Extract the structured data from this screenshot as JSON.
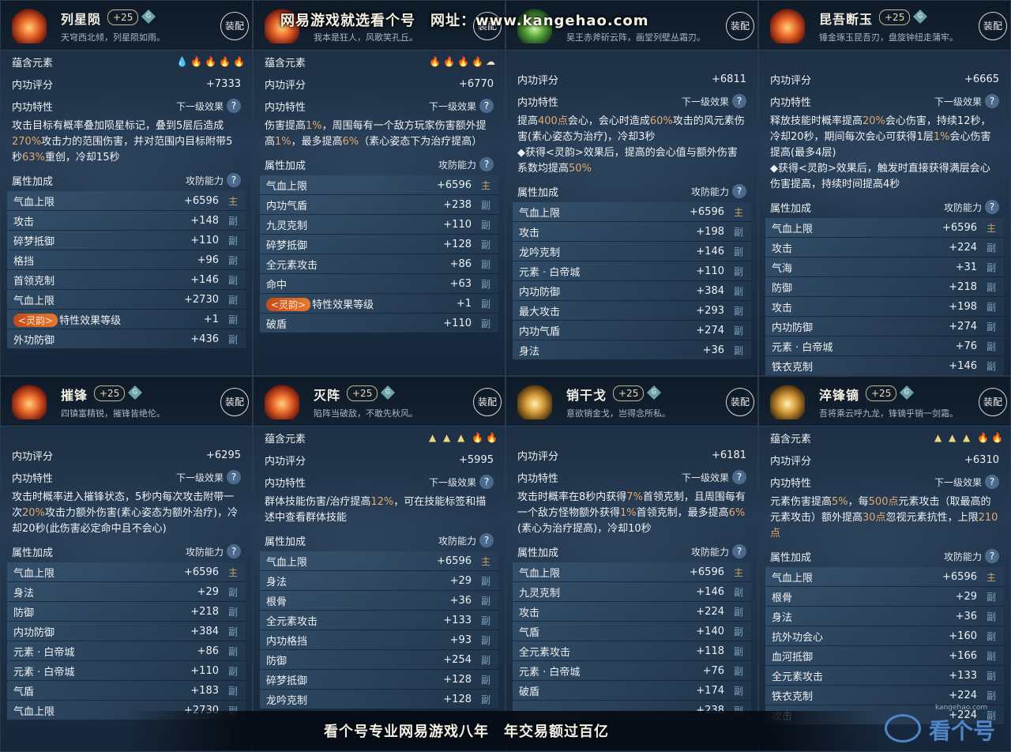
{
  "overlay": {
    "top_watermark": "网易游戏就选看个号　网址：www.kangehao.com",
    "bottom_banner": "看个号专业网易游戏八年　年交易额过百亿",
    "logo_text": "看个号",
    "site_small": "kangehao.com"
  },
  "labels": {
    "elements": "蕴含元素",
    "score": "内功评分",
    "trait": "内功特性",
    "next_effect": "下一级效果",
    "attrs": "属性加成",
    "atk_def": "攻防能力",
    "equip": "装配",
    "help": "?",
    "main": "主",
    "sub": "副",
    "lingyun": "<灵韵>"
  },
  "cards": [
    {
      "name": "列星陨",
      "level": "+25",
      "grade": "G",
      "quote": "天穹西北倾，列星陨如雨。",
      "icon": "fire",
      "elements": [
        "water",
        "fire",
        "fire",
        "fire",
        "fire"
      ],
      "score": "+7333",
      "desc": "攻击目标有概率叠加陨星标记，叠到5层后造成270%攻击力的范围伤害，并对范围内目标附带5秒63%重创，冷却15秒",
      "attrs": [
        {
          "name": "气血上限",
          "val": "+6596",
          "tag": "main"
        },
        {
          "name": "攻击",
          "val": "+148",
          "tag": "sub"
        },
        {
          "name": "碎梦抵御",
          "val": "+110",
          "tag": "sub"
        },
        {
          "name": "格挡",
          "val": "+96",
          "tag": "sub"
        },
        {
          "name": "首领克制",
          "val": "+146",
          "tag": "sub"
        },
        {
          "name": "气血上限",
          "val": "+2730",
          "tag": "sub"
        },
        {
          "name": "特性效果等级",
          "val": "+1",
          "tag": "sub",
          "lingyun": true
        },
        {
          "name": "外功防御",
          "val": "+436",
          "tag": "sub"
        }
      ]
    },
    {
      "name": "",
      "level": "",
      "grade": "",
      "quote": "我本是狂人，风歌笑孔丘。",
      "icon": "fire",
      "elements": [
        "fire",
        "fire",
        "fire",
        "fire",
        "cloud"
      ],
      "score": "+6770",
      "desc": "伤害提高1%，周围每有一个敌方玩家伤害额外提高1%，最多提高6%（素心姿态下为治疗提高）",
      "attrs": [
        {
          "name": "气血上限",
          "val": "+6596",
          "tag": "main"
        },
        {
          "name": "内功气盾",
          "val": "+238",
          "tag": "sub"
        },
        {
          "name": "九灵克制",
          "val": "+110",
          "tag": "sub"
        },
        {
          "name": "碎梦抵御",
          "val": "+128",
          "tag": "sub"
        },
        {
          "name": "全元素攻击",
          "val": "+86",
          "tag": "sub"
        },
        {
          "name": "命中",
          "val": "+63",
          "tag": "sub"
        },
        {
          "name": "特性效果等级",
          "val": "+1",
          "tag": "sub",
          "lingyun": true
        },
        {
          "name": "破盾",
          "val": "+110",
          "tag": "sub"
        }
      ]
    },
    {
      "name": "",
      "level": "",
      "grade": "",
      "quote": "吴王赤斧斫云阵，画堂列壁丛霜刃。",
      "icon": "green",
      "elements": [],
      "score": "+6811",
      "desc": "提高400点会心，会心时造成60%攻击的风元素伤害(素心姿态为治疗)，冷却3秒\n◆获得<灵韵>效果后，提高的会心值与额外伤害系数均提高50%",
      "attrs": [
        {
          "name": "气血上限",
          "val": "+6596",
          "tag": "main"
        },
        {
          "name": "攻击",
          "val": "+198",
          "tag": "sub"
        },
        {
          "name": "龙吟克制",
          "val": "+146",
          "tag": "sub"
        },
        {
          "name": "元素 · 白帝城",
          "val": "+110",
          "tag": "sub"
        },
        {
          "name": "内功防御",
          "val": "+384",
          "tag": "sub"
        },
        {
          "name": "最大攻击",
          "val": "+293",
          "tag": "sub"
        },
        {
          "name": "内功气盾",
          "val": "+274",
          "tag": "sub"
        },
        {
          "name": "身法",
          "val": "+36",
          "tag": "sub"
        }
      ]
    },
    {
      "name": "昆吾断玉",
      "level": "+25",
      "grade": "G",
      "quote": "锤金琢玉昆吾刃，盘旋钟纽走蒲牢。",
      "icon": "fire",
      "elements": [],
      "score": "+6665",
      "desc": "释放技能时概率提高20%会心伤害，持续12秒，冷却20秒，期间每次会心可获得1层1%会心伤害提高(最多4层)\n◆获得<灵韵>效果后，触发时直接获得满层会心伤害提高，持续时间提高4秒",
      "attrs": [
        {
          "name": "气血上限",
          "val": "+6596",
          "tag": "main"
        },
        {
          "name": "攻击",
          "val": "+224",
          "tag": "sub"
        },
        {
          "name": "气海",
          "val": "+31",
          "tag": "sub"
        },
        {
          "name": "防御",
          "val": "+218",
          "tag": "sub"
        },
        {
          "name": "攻击",
          "val": "+198",
          "tag": "sub"
        },
        {
          "name": "内功防御",
          "val": "+274",
          "tag": "sub"
        },
        {
          "name": "元素 · 白帝城",
          "val": "+76",
          "tag": "sub"
        },
        {
          "name": "铁衣克制",
          "val": "+146",
          "tag": "sub"
        }
      ]
    },
    {
      "name": "摧锋",
      "level": "+25",
      "grade": "G",
      "quote": "四镇富精锐，摧锋皆绝伦。",
      "icon": "fire",
      "elements": [],
      "score": "+6295",
      "desc": "攻击时概率进入摧锋状态，5秒内每次攻击附带一次20%攻击力额外伤害(素心姿态为额外治疗)，冷却20秒(此伤害必定命中且不会心)",
      "attrs": [
        {
          "name": "气血上限",
          "val": "+6596",
          "tag": "main"
        },
        {
          "name": "身法",
          "val": "+29",
          "tag": "sub"
        },
        {
          "name": "防御",
          "val": "+218",
          "tag": "sub"
        },
        {
          "name": "内功防御",
          "val": "+384",
          "tag": "sub"
        },
        {
          "name": "元素 · 白帝城",
          "val": "+86",
          "tag": "sub"
        },
        {
          "name": "元素 · 白帝城",
          "val": "+110",
          "tag": "sub"
        },
        {
          "name": "气盾",
          "val": "+183",
          "tag": "sub"
        },
        {
          "name": "气血上限",
          "val": "+2730",
          "tag": "sub"
        }
      ]
    },
    {
      "name": "灭阵",
      "level": "+25",
      "grade": "G",
      "quote": "陷阵当破敌，不敢先秋风。",
      "icon": "fire",
      "elements": [
        "earth",
        "earth",
        "earth",
        "fire",
        "fire"
      ],
      "score": "+5995",
      "desc": "群体技能伤害/治疗提高12%，可在技能标签和描述中查看群体技能",
      "attrs": [
        {
          "name": "气血上限",
          "val": "+6596",
          "tag": "main"
        },
        {
          "name": "身法",
          "val": "+29",
          "tag": "sub"
        },
        {
          "name": "根骨",
          "val": "+36",
          "tag": "sub"
        },
        {
          "name": "全元素攻击",
          "val": "+133",
          "tag": "sub"
        },
        {
          "name": "内功格挡",
          "val": "+93",
          "tag": "sub"
        },
        {
          "name": "防御",
          "val": "+254",
          "tag": "sub"
        },
        {
          "name": "碎梦抵御",
          "val": "+128",
          "tag": "sub"
        },
        {
          "name": "龙吟克制",
          "val": "+128",
          "tag": "sub"
        }
      ]
    },
    {
      "name": "销干戈",
      "level": "+25",
      "grade": "G",
      "quote": "意欲销金戈，岂得念所私。",
      "icon": "gold",
      "elements": [],
      "score": "+6181",
      "desc": "攻击时概率在8秒内获得7%首领克制，且周围每有一个敌方怪物额外获得1%首领克制，最多提高6%(素心为治疗提高)，冷却10秒",
      "attrs": [
        {
          "name": "气血上限",
          "val": "+6596",
          "tag": "main"
        },
        {
          "name": "九灵克制",
          "val": "+146",
          "tag": "sub"
        },
        {
          "name": "攻击",
          "val": "+224",
          "tag": "sub"
        },
        {
          "name": "气盾",
          "val": "+140",
          "tag": "sub"
        },
        {
          "name": "全元素攻击",
          "val": "+118",
          "tag": "sub"
        },
        {
          "name": "元素 · 白帝城",
          "val": "+76",
          "tag": "sub"
        },
        {
          "name": "破盾",
          "val": "+174",
          "tag": "sub"
        },
        {
          "name": "",
          "val": "+238",
          "tag": "sub"
        }
      ]
    },
    {
      "name": "淬锋镝",
      "level": "+25",
      "grade": "G",
      "quote": "吾将乘云呼九龙，锋镝乎销一剑霜。",
      "icon": "gold",
      "elements": [
        "earth",
        "earth",
        "earth",
        "fire",
        "fire"
      ],
      "score": "+6310",
      "desc": "元素伤害提高5%，每500点元素攻击（取最高的元素攻击）额外提高30点忽视元素抗性，上限210点",
      "attrs": [
        {
          "name": "气血上限",
          "val": "+6596",
          "tag": "main"
        },
        {
          "name": "根骨",
          "val": "+29",
          "tag": "sub"
        },
        {
          "name": "身法",
          "val": "+36",
          "tag": "sub"
        },
        {
          "name": "抗外功会心",
          "val": "+160",
          "tag": "sub"
        },
        {
          "name": "血河抵御",
          "val": "+166",
          "tag": "sub"
        },
        {
          "name": "全元素攻击",
          "val": "+133",
          "tag": "sub"
        },
        {
          "name": "铁衣克制",
          "val": "+224",
          "tag": "sub"
        },
        {
          "name": "攻击",
          "val": "+224",
          "tag": "sub"
        }
      ]
    }
  ]
}
